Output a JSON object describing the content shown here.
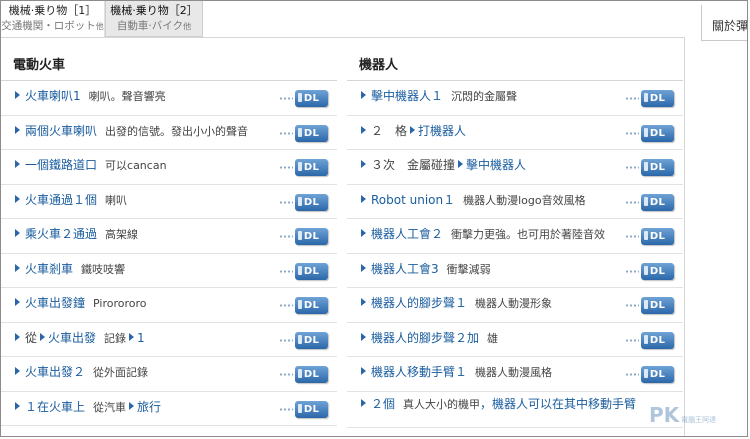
{
  "tabs": [
    {
      "title": "機械·乗り物［1］",
      "subtitle": "交通機関・ロボット",
      "suffix": "他"
    },
    {
      "title": "機械·乗り物［2］",
      "subtitle": "自動車·バイク",
      "suffix": "他"
    }
  ],
  "sidebar": {
    "label": "關於彈"
  },
  "download_label": "DL",
  "left_column": {
    "heading": "電動火車",
    "rows": [
      {
        "title": "火車喇叭1",
        "desc": "喇叭。聲音響亮"
      },
      {
        "title": "兩個火車喇叭",
        "desc": "出發的信號。發出小小的聲音"
      },
      {
        "title": "一個鐵路道口",
        "desc": "可以cancan"
      },
      {
        "title": "火車通過１個",
        "desc": "喇叭"
      },
      {
        "title": "乘火車２通過",
        "desc": "高架線"
      },
      {
        "title": "火車剎車",
        "desc": "鐵吱吱響"
      },
      {
        "title": "火車出發鐘",
        "desc": "Pirorororo"
      },
      {
        "pre": "從",
        "title": "火車出發",
        "desc": "記錄",
        "post_link": "1"
      },
      {
        "title": "火車出發２",
        "desc": "從外面記錄"
      },
      {
        "title": "１在火車上",
        "desc": "從汽車",
        "post_link": "旅行"
      }
    ]
  },
  "right_column": {
    "heading": "機器人",
    "rows": [
      {
        "title": "擊中機器人１",
        "desc": "沉悶的金屬聲"
      },
      {
        "pre": "２　格",
        "title": "打機器人",
        "desc": ""
      },
      {
        "pre": "３次　金屬碰撞",
        "title": "擊中機器人",
        "desc": ""
      },
      {
        "title": "Robot union１",
        "desc": "機器人動漫logo音效風格"
      },
      {
        "title": "機器人工會２",
        "desc": "衝擊力更強。也可用於著陸音效"
      },
      {
        "title": "機器人工會3",
        "desc": "衝擊減弱"
      },
      {
        "title": "機器人的腳步聲１",
        "desc": "機器人動漫形象"
      },
      {
        "title": "機器人的腳步聲２加",
        "desc": "雄"
      },
      {
        "title": "機器人移動手臂１",
        "desc": "機器人動漫風格"
      },
      {
        "title": "２個",
        "desc": "真人大小的機甲",
        "post_link": "，機器人可以在其中移動手臂"
      }
    ]
  },
  "watermark": {
    "text": "PK",
    "sub": "電腦王阿達"
  }
}
